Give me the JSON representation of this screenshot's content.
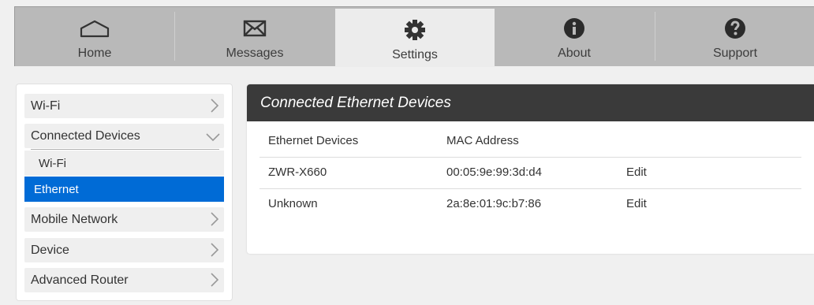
{
  "nav": {
    "tabs": [
      {
        "label": "Home",
        "icon": "home-icon"
      },
      {
        "label": "Messages",
        "icon": "envelope-icon"
      },
      {
        "label": "Settings",
        "icon": "gear-icon",
        "active": true
      },
      {
        "label": "About",
        "icon": "info-icon"
      },
      {
        "label": "Support",
        "icon": "question-icon"
      }
    ]
  },
  "sidebar": {
    "wifi": "Wi-Fi",
    "connected_devices": "Connected Devices",
    "sub_wifi": "Wi-Fi",
    "sub_ethernet": "Ethernet",
    "mobile_network": "Mobile Network",
    "device": "Device",
    "advanced_router": "Advanced Router"
  },
  "panel": {
    "title": "Connected Ethernet Devices",
    "headers": [
      "Ethernet Devices",
      "MAC Address"
    ],
    "rows": [
      {
        "device": "ZWR-X660",
        "mac": "00:05:9e:99:3d:d4",
        "action": "Edit"
      },
      {
        "device": "Unknown",
        "mac": "2a:8e:01:9c:b7:86",
        "action": "Edit"
      }
    ]
  },
  "colors": {
    "accent": "#006bd6",
    "header": "#3a3a3a",
    "nav": "#b9b9b9"
  }
}
